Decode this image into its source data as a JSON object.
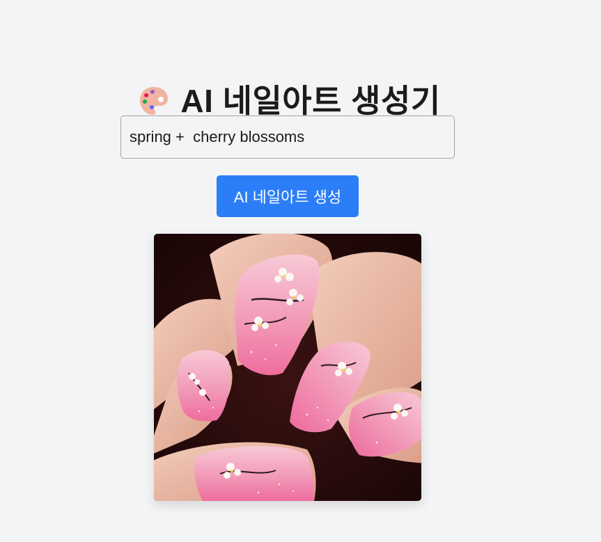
{
  "header": {
    "title": "AI 네일아트 생성기",
    "icon": "palette-icon"
  },
  "prompt": {
    "value": "spring +  cherry blossoms"
  },
  "generate_button": {
    "label": "AI 네일아트 생성"
  },
  "result_image": {
    "description": "generated-nail-art-image",
    "colors": {
      "nail_pink": "#f07aa6",
      "nail_light": "#f6c3d2",
      "skin": "#e9b9a4",
      "background": "#2a0d0d"
    }
  }
}
